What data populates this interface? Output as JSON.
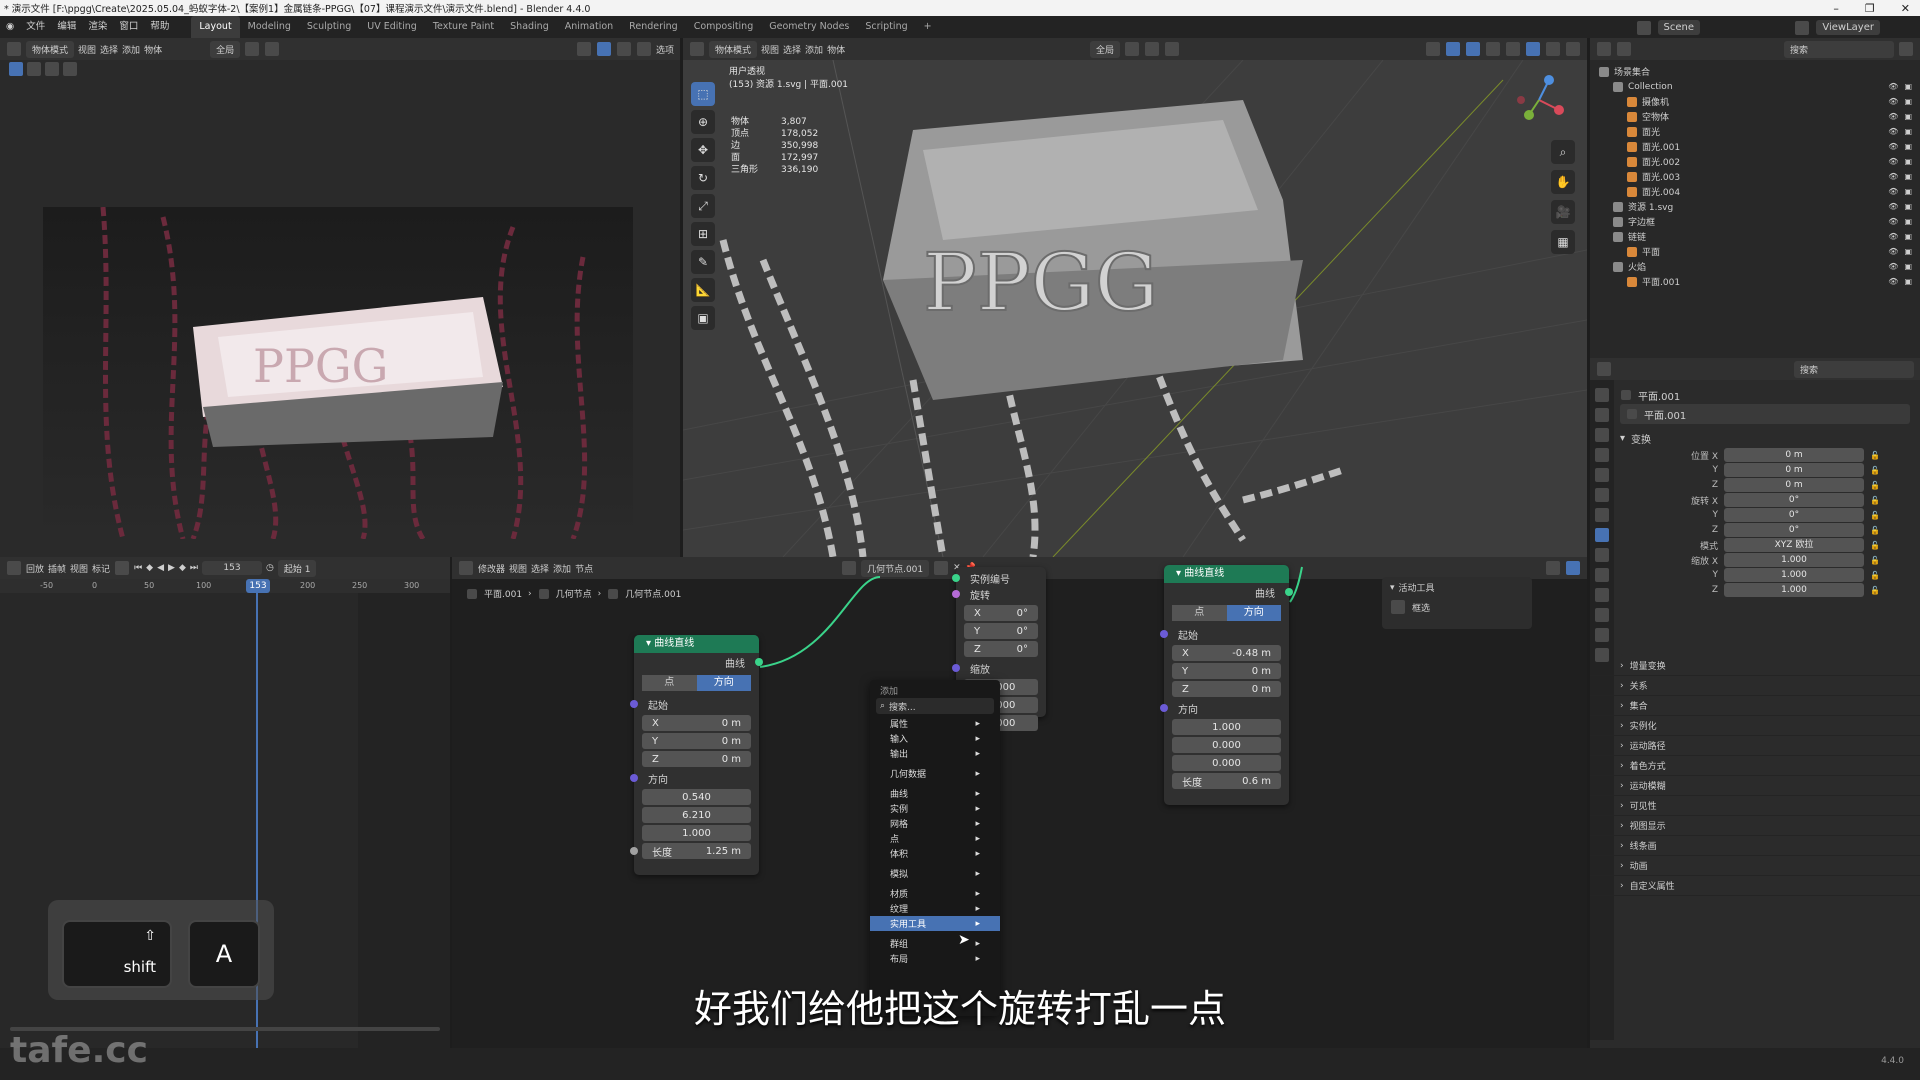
{
  "window": {
    "title": "* 演示文件 [F:\\ppgg\\Create\\2025.05.04_蚂蚁字体-2\\【案例1】金属链条-PPGG\\【07】课程演示文件\\演示文件.blend] - Blender 4.4.0",
    "min": "–",
    "max": "❐",
    "close": "✕"
  },
  "menus": [
    "文件",
    "编辑",
    "渲染",
    "窗口",
    "帮助"
  ],
  "workspaces": [
    "Layout",
    "Modeling",
    "Sculpting",
    "UV Editing",
    "Texture Paint",
    "Shading",
    "Animation",
    "Rendering",
    "Compositing",
    "Geometry Nodes",
    "Scripting"
  ],
  "active_workspace": "Layout",
  "scene_label": "Scene",
  "viewlayer_label": "ViewLayer",
  "left_header": {
    "mode": "物体模式",
    "items": [
      "视图",
      "选择",
      "添加",
      "物体"
    ],
    "global": "全局",
    "options": "选项"
  },
  "viewport": {
    "mode": "物体模式",
    "menu": [
      "视图",
      "选择",
      "添加",
      "物体"
    ],
    "global": "全局",
    "options": "选项",
    "view_name": "用户透视",
    "view_sub": "(153) 资源 1.svg | 平面.001",
    "stats": [
      {
        "k": "物体",
        "v": "3,807"
      },
      {
        "k": "顶点",
        "v": "178,052"
      },
      {
        "k": "边",
        "v": "350,998"
      },
      {
        "k": "面",
        "v": "172,997"
      },
      {
        "k": "三角形",
        "v": "336,190"
      }
    ]
  },
  "outliner": {
    "search_placeholder": "搜索",
    "root": "场景集合",
    "rows": [
      {
        "label": "Collection",
        "indent": 1
      },
      {
        "label": "摄像机",
        "indent": 2
      },
      {
        "label": "空物体",
        "indent": 2
      },
      {
        "label": "面光",
        "indent": 2
      },
      {
        "label": "面光.001",
        "indent": 2
      },
      {
        "label": "面光.002",
        "indent": 2
      },
      {
        "label": "面光.003",
        "indent": 2
      },
      {
        "label": "面光.004",
        "indent": 2
      },
      {
        "label": "资源 1.svg",
        "indent": 1
      },
      {
        "label": "字边框",
        "indent": 1
      },
      {
        "label": "链链",
        "indent": 1
      },
      {
        "label": "平面",
        "indent": 2
      },
      {
        "label": "火焰",
        "indent": 1
      },
      {
        "label": "平面.001",
        "indent": 2
      }
    ]
  },
  "properties": {
    "search_placeholder": "搜索",
    "object_name": "平面.001",
    "object_name2": "平面.001",
    "section": "变换",
    "location_label": "位置 X",
    "location": [
      "0 m",
      "0 m",
      "0 m"
    ],
    "rotation_label": "旋转 X",
    "rotation": [
      "0°",
      "0°",
      "0°"
    ],
    "mode_label": "模式",
    "mode_value": "XYZ 欧拉",
    "scale_label": "缩放 X",
    "scale": [
      "1.000",
      "1.000",
      "1.000"
    ],
    "axis_y": "Y",
    "axis_z": "Z",
    "panels": [
      "增量变换",
      "关系",
      "集合",
      "实例化",
      "运动路径",
      "着色方式",
      "运动模糊",
      "可见性",
      "视图显示",
      "线条画",
      "动画",
      "自定义属性"
    ]
  },
  "timeline": {
    "menus": [
      "回放",
      "插帧",
      "视图",
      "标记"
    ],
    "current_frame": "153",
    "start_label": "起始",
    "start_value": "1",
    "ruler": [
      "-50",
      "0",
      "50",
      "100",
      "153",
      "200",
      "250",
      "300"
    ]
  },
  "node_editor": {
    "menus": [
      "修改器",
      "视图",
      "选择",
      "添加",
      "节点"
    ],
    "tree_name": "几何节点.001",
    "breadcrumb": [
      "平面.001",
      "几何节点",
      "几何节点.001"
    ],
    "side_panel_title": "活动工具",
    "side_panel_item": "框选",
    "node1": {
      "title": "曲线直线",
      "out": "曲线",
      "mode_a": "点",
      "mode_b": "方向",
      "start_label": "起始",
      "start": [
        {
          "k": "X",
          "v": "0 m"
        },
        {
          "k": "Y",
          "v": "0 m"
        },
        {
          "k": "Z",
          "v": "0 m"
        }
      ],
      "dir_label": "方向",
      "dir": [
        "0.540",
        "6.210",
        "1.000"
      ],
      "len_label": "长度",
      "len_value": "1.25 m"
    },
    "node2": {
      "inst_index": "实例编号",
      "rot_label": "旋转",
      "rot": [
        {
          "k": "X",
          "v": "0°"
        },
        {
          "k": "Y",
          "v": "0°"
        },
        {
          "k": "Z",
          "v": "0°"
        }
      ],
      "scale_label": "缩放",
      "scale": [
        "1.000",
        "1.000",
        "1.000"
      ]
    },
    "node3": {
      "title": "曲线直线",
      "out": "曲线",
      "mode_a": "点",
      "mode_b": "方向",
      "start_label": "起始",
      "start": [
        {
          "k": "X",
          "v": "-0.48 m"
        },
        {
          "k": "Y",
          "v": "0 m"
        },
        {
          "k": "Z",
          "v": "0 m"
        }
      ],
      "dir_label": "方向",
      "dir": [
        "1.000",
        "0.000",
        "0.000"
      ],
      "len_label": "长度",
      "len_value": "0.6 m"
    }
  },
  "add_menu": {
    "title": "添加",
    "search": "搜索...",
    "groups": [
      [
        "属性",
        "输入",
        "输出"
      ],
      [
        "几何数据"
      ],
      [
        "曲线",
        "实例",
        "网格",
        "点",
        "体积"
      ],
      [
        "模拟"
      ],
      [
        "材质",
        "纹理",
        "实用工具"
      ],
      [
        "群组",
        "布局"
      ]
    ],
    "highlighted": "实用工具"
  },
  "keycast": {
    "key1": "shift",
    "key1_symbol": "⇧",
    "key2": "A"
  },
  "subtitle": "好我们给他把这个旋转打乱一点",
  "watermark": "tafe.cc",
  "version": "4.4.0",
  "colors": {
    "accent": "#4772b3",
    "node_header": "#1e7a55",
    "link": "#3ad38a"
  }
}
